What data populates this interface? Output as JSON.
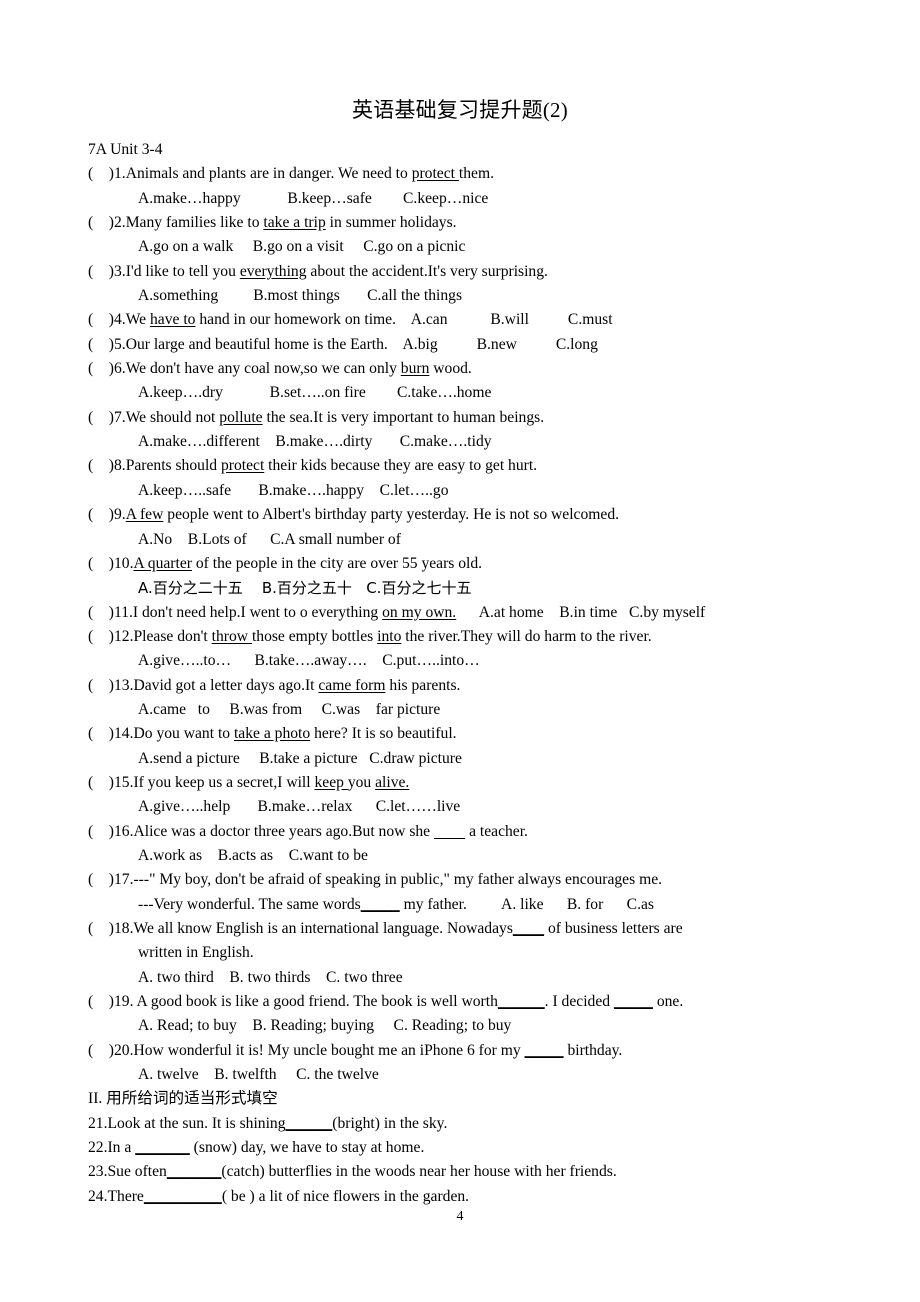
{
  "document": {
    "title": "英语基础复习提升题(2)",
    "unit_label": "7A Unit 3-4",
    "page_number": "4",
    "section_two_heading": "II. 用所给词的适当形式填空"
  },
  "section_one": {
    "questions": [
      {
        "marker": "(    )1.",
        "stem_parts": [
          {
            "text": "Animals and plants are in danger. We need to ",
            "underline": false
          },
          {
            "text": "protect ",
            "underline": true
          },
          {
            "text": "them.",
            "underline": false
          }
        ],
        "options_line": "A.make…happy            B.keep…safe        C.keep…nice",
        "options": [
          "A.make…happy",
          "B.keep…safe",
          "C.keep…nice"
        ],
        "inline_options": false
      },
      {
        "marker": "(    )2.",
        "stem_parts": [
          {
            "text": "Many families like to ",
            "underline": false
          },
          {
            "text": "take a trip",
            "underline": true
          },
          {
            "text": " in summer holidays.",
            "underline": false
          }
        ],
        "options_line": "A.go on a walk     B.go on a visit     C.go on a picnic",
        "options": [
          "A.go on a walk",
          "B.go on a visit",
          "C.go on a picnic"
        ],
        "inline_options": false
      },
      {
        "marker": "(    )3.",
        "stem_parts": [
          {
            "text": "I'd like to tell you ",
            "underline": false
          },
          {
            "text": "everything",
            "underline": true
          },
          {
            "text": " about the accident.It's very surprising.",
            "underline": false
          }
        ],
        "options_line": "A.something         B.most things       C.all the things",
        "options": [
          "A.something",
          "B.most things",
          "C.all the things"
        ],
        "inline_options": false
      },
      {
        "marker": "(    )4.",
        "stem_parts": [
          {
            "text": "We ",
            "underline": false
          },
          {
            "text": "have to",
            "underline": true
          },
          {
            "text": " hand in our homework on time.    A.can           B.will          C.must",
            "underline": false
          }
        ],
        "options_line": "",
        "options": [
          "A.can",
          "B.will",
          "C.must"
        ],
        "inline_options": true
      },
      {
        "marker": "(    )5.",
        "stem_parts": [
          {
            "text": "Our large and beautiful home is the Earth.    A.big          B.new          C.long",
            "underline": false
          }
        ],
        "options_line": "",
        "options": [
          "A.big",
          "B.new",
          "C.long"
        ],
        "inline_options": true
      },
      {
        "marker": "(    )6.",
        "stem_parts": [
          {
            "text": "We don't have any coal now,so we can only ",
            "underline": false
          },
          {
            "text": "burn",
            "underline": true
          },
          {
            "text": " wood.",
            "underline": false
          }
        ],
        "options_line": "A.keep….dry            B.set…..on fire        C.take….home",
        "options": [
          "A.keep….dry",
          "B.set…..on fire",
          "C.take….home"
        ],
        "inline_options": false
      },
      {
        "marker": "(    )7.",
        "stem_parts": [
          {
            "text": "We should not ",
            "underline": false
          },
          {
            "text": "pollute",
            "underline": true
          },
          {
            "text": " the sea.It is very important to human beings.",
            "underline": false
          }
        ],
        "options_line": "A.make….different    B.make….dirty       C.make….tidy",
        "options": [
          "A.make….different",
          "B.make….dirty",
          "C.make….tidy"
        ],
        "inline_options": false
      },
      {
        "marker": "(    )8.",
        "stem_parts": [
          {
            "text": "Parents should ",
            "underline": false
          },
          {
            "text": "protect",
            "underline": true
          },
          {
            "text": " their kids because they are easy to get hurt.",
            "underline": false
          }
        ],
        "options_line": "A.keep…..safe       B.make….happy    C.let…..go",
        "options": [
          "A.keep…..safe",
          "B.make….happy",
          "C.let…..go"
        ],
        "inline_options": false
      },
      {
        "marker": "(    )9.",
        "stem_parts": [
          {
            "text": "A few",
            "underline": true
          },
          {
            "text": " people went to Albert's birthday party yesterday. He is not so welcomed.",
            "underline": false
          }
        ],
        "options_line": "A.No    B.Lots of      C.A small number of",
        "options": [
          "A.No",
          "B.Lots of",
          "C.A small number of"
        ],
        "inline_options": false
      },
      {
        "marker": "(    )10.",
        "stem_parts": [
          {
            "text": "A quarter",
            "underline": true
          },
          {
            "text": " of the people in the city are over 55 years old.",
            "underline": false
          }
        ],
        "options_line": "A.百分之二十五    B.百分之五十   C.百分之七十五",
        "options": [
          "A.百分之二十五",
          "B.百分之五十",
          "C.百分之七十五"
        ],
        "inline_options": false,
        "options_cjk": true
      },
      {
        "marker": "(    )11.",
        "stem_parts": [
          {
            "text": "I don't need help.I went to o everything ",
            "underline": false
          },
          {
            "text": "on my own.",
            "underline": true
          },
          {
            "text": "      A.at home    B.in time   C.by myself",
            "underline": false
          }
        ],
        "options_line": "",
        "options": [
          "A.at home",
          "B.in time",
          "C.by myself"
        ],
        "inline_options": true
      },
      {
        "marker": "(    )12.",
        "stem_parts": [
          {
            "text": "Please don't ",
            "underline": false
          },
          {
            "text": "throw ",
            "underline": true
          },
          {
            "text": "those empty bottles ",
            "underline": false
          },
          {
            "text": "into",
            "underline": true
          },
          {
            "text": " the river.They will do harm to the river.",
            "underline": false
          }
        ],
        "options_line": "A.give…..to…      B.take….away….    C.put…..into…",
        "options": [
          "A.give…..to…",
          "B.take….away….",
          "C.put…..into…"
        ],
        "inline_options": false
      },
      {
        "marker": "(    )13.",
        "stem_parts": [
          {
            "text": "David got a letter days ago.It ",
            "underline": false
          },
          {
            "text": "came form",
            "underline": true
          },
          {
            "text": " his parents.",
            "underline": false
          }
        ],
        "options_line": "A.came   to     B.was from     C.was    far picture",
        "options": [
          "A.came   to",
          "B.was from",
          "C.was    far picture"
        ],
        "inline_options": false
      },
      {
        "marker": "(    )14.",
        "stem_parts": [
          {
            "text": "Do you want to ",
            "underline": false
          },
          {
            "text": "take a photo",
            "underline": true
          },
          {
            "text": " here? It is so beautiful.",
            "underline": false
          }
        ],
        "options_line": "A.send a picture     B.take a picture   C.draw picture",
        "options": [
          "A.send a picture",
          "B.take a picture",
          "C.draw picture"
        ],
        "inline_options": false
      },
      {
        "marker": "(    )15.",
        "stem_parts": [
          {
            "text": "If you keep us a secret,I will ",
            "underline": false
          },
          {
            "text": "keep ",
            "underline": true
          },
          {
            "text": "you ",
            "underline": false
          },
          {
            "text": "alive.",
            "underline": true
          }
        ],
        "options_line": "A.give…..help       B.make…relax      C.let……live",
        "options": [
          "A.give…..help",
          "B.make…relax",
          "C.let……live"
        ],
        "inline_options": false
      },
      {
        "marker": "(    )16.",
        "stem_parts": [
          {
            "text": "Alice was a doctor three years ago.But now she ",
            "underline": false
          },
          {
            "text": "        ",
            "underline": true
          },
          {
            "text": " a teacher.",
            "underline": false
          }
        ],
        "options_line": "A.work as    B.acts as    C.want to be",
        "options": [
          "A.work as",
          "B.acts as",
          "C.want to be"
        ],
        "inline_options": false
      },
      {
        "marker": "(    )17.",
        "stem_parts": [
          {
            "text": "---\" My boy, don't be afraid of speaking in public,\" my father always encourages me.",
            "underline": false
          }
        ],
        "second_line_parts": [
          {
            "text": "---Very wonderful. The same words",
            "underline": false
          },
          {
            "text": "_____",
            "underline": true
          },
          {
            "text": " my father.         A. like      B. for      C.as",
            "underline": false
          }
        ],
        "options_line": "",
        "options": [
          "A. like",
          "B. for",
          "C.as"
        ],
        "inline_options": true
      },
      {
        "marker": "(    )18.",
        "stem_parts": [
          {
            "text": "We all know English is an international language. Nowadays",
            "underline": false
          },
          {
            "text": "____",
            "underline": true
          },
          {
            "text": " of business letters are",
            "underline": false
          }
        ],
        "continuation": "written in English.",
        "options_line": "A. two third    B. two thirds    C. two three",
        "options": [
          "A. two third",
          "B. two thirds",
          "C. two three"
        ],
        "inline_options": false
      },
      {
        "marker": "(    )19.",
        "stem_parts": [
          {
            "text": " A good book is like a good friend. The book is well worth",
            "underline": false
          },
          {
            "text": "______",
            "underline": true
          },
          {
            "text": ". I decided ",
            "underline": false
          },
          {
            "text": "_____",
            "underline": true
          },
          {
            "text": " one.",
            "underline": false
          }
        ],
        "options_line": "A. Read; to buy    B. Reading; buying     C. Reading; to buy",
        "options": [
          "A. Read; to buy",
          "B. Reading; buying",
          "C. Reading; to buy"
        ],
        "inline_options": false
      },
      {
        "marker": "(    )20.",
        "stem_parts": [
          {
            "text": "How wonderful it is! My uncle bought me an iPhone 6 for my ",
            "underline": false
          },
          {
            "text": "_____",
            "underline": true
          },
          {
            "text": " birthday.",
            "underline": false
          }
        ],
        "options_line": "A. twelve    B. twelfth     C. the twelve",
        "options": [
          "A. twelve",
          "B. twelfth",
          "C. the twelve"
        ],
        "inline_options": false
      }
    ]
  },
  "section_two": {
    "items": [
      {
        "parts": [
          {
            "text": "21.Look at the sun. It is shining",
            "underline": false
          },
          {
            "text": "______",
            "underline": true
          },
          {
            "text": "(bright) in the sky.",
            "underline": false
          }
        ]
      },
      {
        "parts": [
          {
            "text": "22.In a ",
            "underline": false
          },
          {
            "text": "_______",
            "underline": true
          },
          {
            "text": " (snow) day, we have to stay at home.",
            "underline": false
          }
        ]
      },
      {
        "parts": [
          {
            "text": "23.Sue often",
            "underline": false
          },
          {
            "text": "_______",
            "underline": true
          },
          {
            "text": "(catch) butterflies in the woods near her house with her friends.",
            "underline": false
          }
        ]
      },
      {
        "parts": [
          {
            "text": "24.There",
            "underline": false
          },
          {
            "text": "__________",
            "underline": true
          },
          {
            "text": "( be ) a lit of nice flowers in the garden.",
            "underline": false
          }
        ]
      }
    ]
  }
}
